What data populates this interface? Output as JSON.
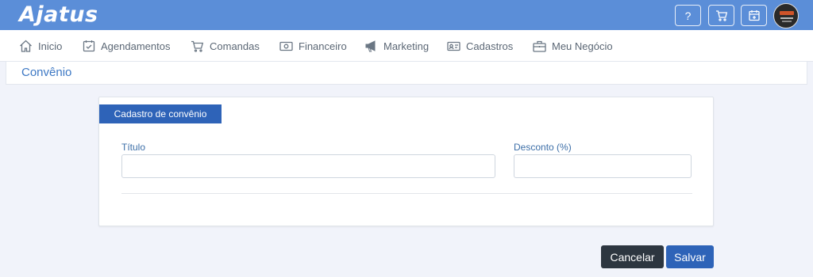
{
  "header": {
    "logo_text": "Ajatus",
    "help_label": "?",
    "buttons": [
      "help-button",
      "cart-button",
      "calendar-button"
    ],
    "colors": {
      "topbar": "#5b8ed8",
      "accent": "#2e63b8",
      "dark": "#2d3640"
    }
  },
  "nav": {
    "items": [
      {
        "label": "Inicio",
        "icon": "home-icon"
      },
      {
        "label": "Agendamentos",
        "icon": "calendar-check-icon"
      },
      {
        "label": "Comandas",
        "icon": "cart-icon"
      },
      {
        "label": "Financeiro",
        "icon": "money-icon"
      },
      {
        "label": "Marketing",
        "icon": "megaphone-icon"
      },
      {
        "label": "Cadastros",
        "icon": "id-card-icon"
      },
      {
        "label": "Meu Negócio",
        "icon": "briefcase-icon"
      }
    ]
  },
  "page": {
    "title": "Convênio"
  },
  "form": {
    "tab_label": "Cadastro de convênio",
    "titulo_label": "Título",
    "titulo_value": "",
    "desconto_label": "Desconto (%)",
    "desconto_value": ""
  },
  "actions": {
    "cancel_label": "Cancelar",
    "save_label": "Salvar"
  }
}
